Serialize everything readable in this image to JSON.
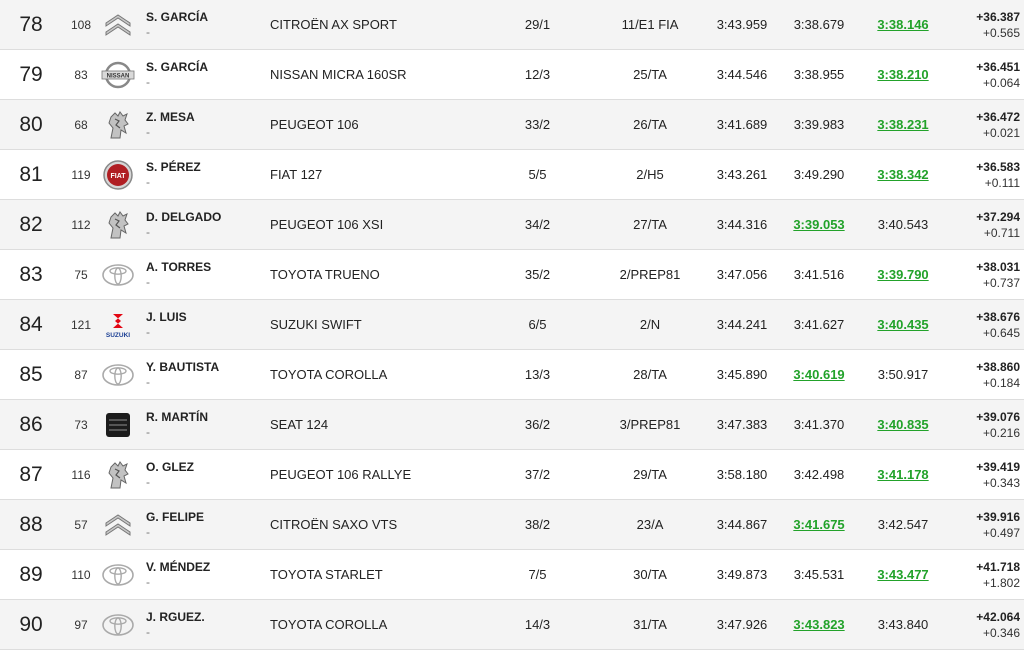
{
  "rows": [
    {
      "pos": "78",
      "num": "108",
      "brand": "citroen-logo-icon",
      "driver": "S. GARCÍA",
      "codriver": "-",
      "car": "CITROËN AX SPORT",
      "class": "29/1",
      "group": "11/E1 FIA",
      "t1": "3:43.959",
      "t2": "3:38.679",
      "t3": "3:38.146",
      "best": 3,
      "gap": "+36.387",
      "diff": "+0.565"
    },
    {
      "pos": "79",
      "num": "83",
      "brand": "nissan-logo-icon",
      "driver": "S. GARCÍA",
      "codriver": "-",
      "car": "NISSAN MICRA 160SR",
      "class": "12/3",
      "group": "25/TA",
      "t1": "3:44.546",
      "t2": "3:38.955",
      "t3": "3:38.210",
      "best": 3,
      "gap": "+36.451",
      "diff": "+0.064"
    },
    {
      "pos": "80",
      "num": "68",
      "brand": "peugeot-logo-icon",
      "driver": "Z. MESA",
      "codriver": "-",
      "car": "PEUGEOT 106",
      "class": "33/2",
      "group": "26/TA",
      "t1": "3:41.689",
      "t2": "3:39.983",
      "t3": "3:38.231",
      "best": 3,
      "gap": "+36.472",
      "diff": "+0.021"
    },
    {
      "pos": "81",
      "num": "119",
      "brand": "fiat-logo-icon",
      "driver": "S. PÉREZ",
      "codriver": "-",
      "car": "FIAT 127",
      "class": "5/5",
      "group": "2/H5",
      "t1": "3:43.261",
      "t2": "3:49.290",
      "t3": "3:38.342",
      "best": 3,
      "gap": "+36.583",
      "diff": "+0.111"
    },
    {
      "pos": "82",
      "num": "112",
      "brand": "peugeot-logo-icon",
      "driver": "D. DELGADO",
      "codriver": "-",
      "car": "PEUGEOT 106 XSI",
      "class": "34/2",
      "group": "27/TA",
      "t1": "3:44.316",
      "t2": "3:39.053",
      "t3": "3:40.543",
      "best": 2,
      "gap": "+37.294",
      "diff": "+0.711"
    },
    {
      "pos": "83",
      "num": "75",
      "brand": "toyota-logo-icon",
      "driver": "A. TORRES",
      "codriver": "-",
      "car": "TOYOTA TRUENO",
      "class": "35/2",
      "group": "2/PREP81",
      "t1": "3:47.056",
      "t2": "3:41.516",
      "t3": "3:39.790",
      "best": 3,
      "gap": "+38.031",
      "diff": "+0.737"
    },
    {
      "pos": "84",
      "num": "121",
      "brand": "suzuki-logo-icon",
      "driver": "J. LUIS",
      "codriver": "-",
      "car": "SUZUKI SWIFT",
      "class": "6/5",
      "group": "2/N",
      "t1": "3:44.241",
      "t2": "3:41.627",
      "t3": "3:40.435",
      "best": 3,
      "gap": "+38.676",
      "diff": "+0.645"
    },
    {
      "pos": "85",
      "num": "87",
      "brand": "toyota-logo-icon",
      "driver": "Y. BAUTISTA",
      "codriver": "-",
      "car": "TOYOTA COROLLA",
      "class": "13/3",
      "group": "28/TA",
      "t1": "3:45.890",
      "t2": "3:40.619",
      "t3": "3:50.917",
      "best": 2,
      "gap": "+38.860",
      "diff": "+0.184"
    },
    {
      "pos": "86",
      "num": "73",
      "brand": "seat-logo-icon",
      "driver": "R. MARTÍN",
      "codriver": "-",
      "car": "SEAT 124",
      "class": "36/2",
      "group": "3/PREP81",
      "t1": "3:47.383",
      "t2": "3:41.370",
      "t3": "3:40.835",
      "best": 3,
      "gap": "+39.076",
      "diff": "+0.216"
    },
    {
      "pos": "87",
      "num": "116",
      "brand": "peugeot-logo-icon",
      "driver": "O. GLEZ",
      "codriver": "-",
      "car": "PEUGEOT 106 RALLYE",
      "class": "37/2",
      "group": "29/TA",
      "t1": "3:58.180",
      "t2": "3:42.498",
      "t3": "3:41.178",
      "best": 3,
      "gap": "+39.419",
      "diff": "+0.343"
    },
    {
      "pos": "88",
      "num": "57",
      "brand": "citroen-logo-icon",
      "driver": "G. FELIPE",
      "codriver": "-",
      "car": "CITROËN SAXO VTS",
      "class": "38/2",
      "group": "23/A",
      "t1": "3:44.867",
      "t2": "3:41.675",
      "t3": "3:42.547",
      "best": 2,
      "gap": "+39.916",
      "diff": "+0.497"
    },
    {
      "pos": "89",
      "num": "110",
      "brand": "toyota-logo-icon",
      "driver": "V. MÉNDEZ",
      "codriver": "-",
      "car": "TOYOTA STARLET",
      "class": "7/5",
      "group": "30/TA",
      "t1": "3:49.873",
      "t2": "3:45.531",
      "t3": "3:43.477",
      "best": 3,
      "gap": "+41.718",
      "diff": "+1.802"
    },
    {
      "pos": "90",
      "num": "97",
      "brand": "toyota-logo-icon",
      "driver": "J. RGUEZ.",
      "codriver": "-",
      "car": "TOYOTA COROLLA",
      "class": "14/3",
      "group": "31/TA",
      "t1": "3:47.926",
      "t2": "3:43.823",
      "t3": "3:43.840",
      "best": 2,
      "gap": "+42.064",
      "diff": "+0.346"
    }
  ],
  "brand_logos": {
    "nissan_text": "NISSAN",
    "suzuki_text": "SUZUKI",
    "fiat_text": "FIAT"
  },
  "colors": {
    "best_time": "#22a22a",
    "row_alt": "#f4f4f4",
    "row_border": "#dddddd",
    "fiat_red": "#b01e23",
    "suzuki_red": "#e30613",
    "suzuki_blue": "#1b3f94"
  }
}
